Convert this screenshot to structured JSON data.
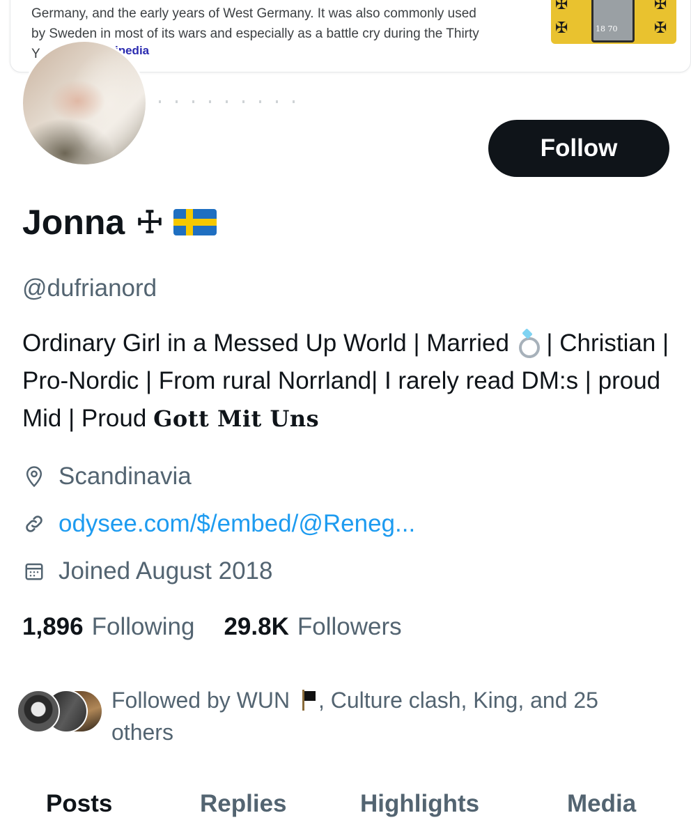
{
  "wiki_card": {
    "text_line1": "Germany, and the early years of West Germany. It was also commonly used",
    "text_line2": "by Sweden in most of its wars and especially as a battle cry during the Thirty",
    "text_line3": "Y",
    "source_label": "ipedia",
    "image_year": "18    70",
    "image_icon": "iron-cross-flag-image"
  },
  "profile": {
    "display_name": "Jonna",
    "name_symbol": "☩",
    "flag": "swedish-flag",
    "handle": "@dufrianord",
    "follow_label": "Follow",
    "bio_part1": "Ordinary Girl in a Messed Up World | Married ",
    "bio_part2": " | Christian | Pro-Nordic | From rural Norrland| I rarely read DM:s | proud Mid | Proud ",
    "bio_gothic": "Gott Mit Uns",
    "location": "Scandinavia",
    "website": "odysee.com/$/embed/@Reneg...",
    "joined": "Joined August 2018",
    "following_count": "1,896",
    "following_label": "Following",
    "followers_count": "29.8K",
    "followers_label": "Followers",
    "followed_by_part1": "Followed by WUN ",
    "followed_by_part2": ", Culture clash, King, and 25 others"
  },
  "tabs": [
    {
      "label": "Posts",
      "active": true
    },
    {
      "label": "Replies",
      "active": false
    },
    {
      "label": "Highlights",
      "active": false
    },
    {
      "label": "Media",
      "active": false
    }
  ],
  "colors": {
    "accent_link": "#1d9bf0",
    "secondary_text": "#536471",
    "primary_text": "#0f1419",
    "button_bg": "#0f1419"
  }
}
